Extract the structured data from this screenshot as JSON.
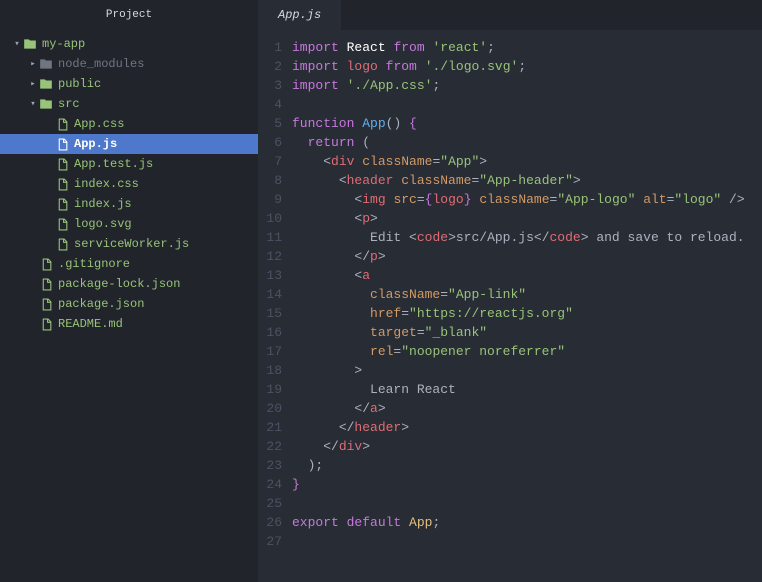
{
  "sidebar": {
    "title": "Project",
    "tree": [
      {
        "depth": 0,
        "kind": "folder",
        "open": true,
        "label": "my-app",
        "color": "green",
        "chev": "▾"
      },
      {
        "depth": 1,
        "kind": "folder",
        "open": false,
        "label": "node_modules",
        "color": "muted",
        "chev": "▸"
      },
      {
        "depth": 1,
        "kind": "folder",
        "open": false,
        "label": "public",
        "color": "green",
        "chev": "▸"
      },
      {
        "depth": 1,
        "kind": "folder",
        "open": true,
        "label": "src",
        "color": "green",
        "chev": "▾"
      },
      {
        "depth": 2,
        "kind": "file",
        "label": "App.css",
        "color": "green"
      },
      {
        "depth": 2,
        "kind": "file",
        "label": "App.js",
        "color": "white",
        "selected": true
      },
      {
        "depth": 2,
        "kind": "file",
        "label": "App.test.js",
        "color": "green"
      },
      {
        "depth": 2,
        "kind": "file",
        "label": "index.css",
        "color": "green"
      },
      {
        "depth": 2,
        "kind": "file",
        "label": "index.js",
        "color": "green"
      },
      {
        "depth": 2,
        "kind": "file",
        "label": "logo.svg",
        "color": "green"
      },
      {
        "depth": 2,
        "kind": "file",
        "label": "serviceWorker.js",
        "color": "green"
      },
      {
        "depth": 1,
        "kind": "file",
        "label": ".gitignore",
        "color": "green"
      },
      {
        "depth": 1,
        "kind": "file",
        "label": "package-lock.json",
        "color": "green"
      },
      {
        "depth": 1,
        "kind": "file",
        "label": "package.json",
        "color": "green"
      },
      {
        "depth": 1,
        "kind": "file",
        "label": "README.md",
        "color": "green"
      }
    ]
  },
  "editor": {
    "active_tab": "App.js",
    "lines": [
      [
        {
          "c": "keyword",
          "t": "import"
        },
        {
          "c": "default",
          "t": " "
        },
        {
          "c": "white",
          "t": "React"
        },
        {
          "c": "default",
          "t": " "
        },
        {
          "c": "keyword",
          "t": "from"
        },
        {
          "c": "default",
          "t": " "
        },
        {
          "c": "string",
          "t": "'react'"
        },
        {
          "c": "punct",
          "t": ";"
        }
      ],
      [
        {
          "c": "keyword",
          "t": "import"
        },
        {
          "c": "default",
          "t": " "
        },
        {
          "c": "ident",
          "t": "logo"
        },
        {
          "c": "default",
          "t": " "
        },
        {
          "c": "keyword",
          "t": "from"
        },
        {
          "c": "default",
          "t": " "
        },
        {
          "c": "string",
          "t": "'./logo.svg'"
        },
        {
          "c": "punct",
          "t": ";"
        }
      ],
      [
        {
          "c": "keyword",
          "t": "import"
        },
        {
          "c": "default",
          "t": " "
        },
        {
          "c": "string",
          "t": "'./App.css'"
        },
        {
          "c": "punct",
          "t": ";"
        }
      ],
      [],
      [
        {
          "c": "keyword",
          "t": "function"
        },
        {
          "c": "default",
          "t": " "
        },
        {
          "c": "func",
          "t": "App"
        },
        {
          "c": "punct",
          "t": "() "
        },
        {
          "c": "brace",
          "t": "{"
        }
      ],
      [
        {
          "c": "default",
          "t": "  "
        },
        {
          "c": "keyword",
          "t": "return"
        },
        {
          "c": "default",
          "t": " "
        },
        {
          "c": "punct",
          "t": "("
        }
      ],
      [
        {
          "c": "default",
          "t": "    "
        },
        {
          "c": "punct",
          "t": "<"
        },
        {
          "c": "tag",
          "t": "div"
        },
        {
          "c": "default",
          "t": " "
        },
        {
          "c": "attr",
          "t": "className"
        },
        {
          "c": "punct",
          "t": "="
        },
        {
          "c": "string",
          "t": "\"App\""
        },
        {
          "c": "punct",
          "t": ">"
        }
      ],
      [
        {
          "c": "default",
          "t": "      "
        },
        {
          "c": "punct",
          "t": "<"
        },
        {
          "c": "tag",
          "t": "header"
        },
        {
          "c": "default",
          "t": " "
        },
        {
          "c": "attr",
          "t": "className"
        },
        {
          "c": "punct",
          "t": "="
        },
        {
          "c": "string",
          "t": "\"App-header\""
        },
        {
          "c": "punct",
          "t": ">"
        }
      ],
      [
        {
          "c": "default",
          "t": "        "
        },
        {
          "c": "punct",
          "t": "<"
        },
        {
          "c": "tag",
          "t": "img"
        },
        {
          "c": "default",
          "t": " "
        },
        {
          "c": "attr",
          "t": "src"
        },
        {
          "c": "punct",
          "t": "="
        },
        {
          "c": "brace",
          "t": "{"
        },
        {
          "c": "ident",
          "t": "logo"
        },
        {
          "c": "brace",
          "t": "}"
        },
        {
          "c": "default",
          "t": " "
        },
        {
          "c": "attr",
          "t": "className"
        },
        {
          "c": "punct",
          "t": "="
        },
        {
          "c": "string",
          "t": "\"App-logo\""
        },
        {
          "c": "default",
          "t": " "
        },
        {
          "c": "attr",
          "t": "alt"
        },
        {
          "c": "punct",
          "t": "="
        },
        {
          "c": "string",
          "t": "\"logo\""
        },
        {
          "c": "default",
          "t": " "
        },
        {
          "c": "punct",
          "t": "/>"
        }
      ],
      [
        {
          "c": "default",
          "t": "        "
        },
        {
          "c": "punct",
          "t": "<"
        },
        {
          "c": "tag",
          "t": "p"
        },
        {
          "c": "punct",
          "t": ">"
        }
      ],
      [
        {
          "c": "default",
          "t": "          Edit "
        },
        {
          "c": "punct",
          "t": "<"
        },
        {
          "c": "tag",
          "t": "code"
        },
        {
          "c": "punct",
          "t": ">"
        },
        {
          "c": "default",
          "t": "src/App.js"
        },
        {
          "c": "punct",
          "t": "</"
        },
        {
          "c": "tag",
          "t": "code"
        },
        {
          "c": "punct",
          "t": ">"
        },
        {
          "c": "default",
          "t": " and save to reload."
        }
      ],
      [
        {
          "c": "default",
          "t": "        "
        },
        {
          "c": "punct",
          "t": "</"
        },
        {
          "c": "tag",
          "t": "p"
        },
        {
          "c": "punct",
          "t": ">"
        }
      ],
      [
        {
          "c": "default",
          "t": "        "
        },
        {
          "c": "punct",
          "t": "<"
        },
        {
          "c": "tag",
          "t": "a"
        }
      ],
      [
        {
          "c": "default",
          "t": "          "
        },
        {
          "c": "attr",
          "t": "className"
        },
        {
          "c": "punct",
          "t": "="
        },
        {
          "c": "string",
          "t": "\"App-link\""
        }
      ],
      [
        {
          "c": "default",
          "t": "          "
        },
        {
          "c": "attr",
          "t": "href"
        },
        {
          "c": "punct",
          "t": "="
        },
        {
          "c": "string",
          "t": "\"https://reactjs.org\""
        }
      ],
      [
        {
          "c": "default",
          "t": "          "
        },
        {
          "c": "attr",
          "t": "target"
        },
        {
          "c": "punct",
          "t": "="
        },
        {
          "c": "string",
          "t": "\"_blank\""
        }
      ],
      [
        {
          "c": "default",
          "t": "          "
        },
        {
          "c": "attr",
          "t": "rel"
        },
        {
          "c": "punct",
          "t": "="
        },
        {
          "c": "string",
          "t": "\"noopener noreferrer\""
        }
      ],
      [
        {
          "c": "default",
          "t": "        "
        },
        {
          "c": "punct",
          "t": ">"
        }
      ],
      [
        {
          "c": "default",
          "t": "          Learn React"
        }
      ],
      [
        {
          "c": "default",
          "t": "        "
        },
        {
          "c": "punct",
          "t": "</"
        },
        {
          "c": "tag",
          "t": "a"
        },
        {
          "c": "punct",
          "t": ">"
        }
      ],
      [
        {
          "c": "default",
          "t": "      "
        },
        {
          "c": "punct",
          "t": "</"
        },
        {
          "c": "tag",
          "t": "header"
        },
        {
          "c": "punct",
          "t": ">"
        }
      ],
      [
        {
          "c": "default",
          "t": "    "
        },
        {
          "c": "punct",
          "t": "</"
        },
        {
          "c": "tag",
          "t": "div"
        },
        {
          "c": "punct",
          "t": ">"
        }
      ],
      [
        {
          "c": "default",
          "t": "  "
        },
        {
          "c": "punct",
          "t": ");"
        }
      ],
      [
        {
          "c": "brace",
          "t": "}"
        }
      ],
      [],
      [
        {
          "c": "keyword",
          "t": "export"
        },
        {
          "c": "default",
          "t": " "
        },
        {
          "c": "keyword",
          "t": "default"
        },
        {
          "c": "default",
          "t": " "
        },
        {
          "c": "yellow",
          "t": "App"
        },
        {
          "c": "punct",
          "t": ";"
        }
      ],
      []
    ]
  }
}
